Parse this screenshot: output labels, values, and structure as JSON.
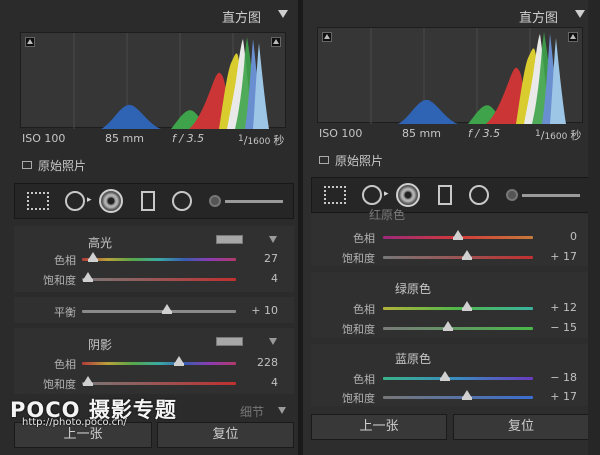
{
  "left_panel": {
    "histogram_title": "直方图",
    "exif": {
      "iso": "ISO 100",
      "focal": "85 mm",
      "aperture": "f / 3.5",
      "shutter_num": "1",
      "shutter_den": "1600",
      "shutter_unit": "秒"
    },
    "original_photo_label": "原始照片",
    "highlights": {
      "title": "高光",
      "hue_label": "色相",
      "hue_value": "27",
      "hue_pos": 0.07,
      "sat_label": "饱和度",
      "sat_value": "4",
      "sat_pos": 0.04
    },
    "balance": {
      "label": "平衡",
      "value": "+ 10",
      "pos": 0.55
    },
    "shadows": {
      "title": "阴影",
      "hue_label": "色相",
      "hue_value": "228",
      "hue_pos": 0.63,
      "sat_label": "饱和度",
      "sat_value": "4",
      "sat_pos": 0.04
    },
    "footer_title": "细节",
    "prev_button": "上一张",
    "reset_button": "复位"
  },
  "right_panel": {
    "histogram_title": "直方图",
    "exif": {
      "iso": "ISO 100",
      "focal": "85 mm",
      "aperture": "f / 3.5",
      "shutter_num": "1",
      "shutter_den": "1600",
      "shutter_unit": "秒"
    },
    "original_photo_label": "原始照片",
    "red_primary": {
      "title": "红原色",
      "hue_label": "色相",
      "hue_value": "0",
      "hue_pos": 0.5,
      "sat_label": "饱和度",
      "sat_value": "+ 17",
      "sat_pos": 0.56
    },
    "green_primary": {
      "title": "绿原色",
      "hue_label": "色相",
      "hue_value": "+ 12",
      "hue_pos": 0.56,
      "sat_label": "饱和度",
      "sat_value": "− 15",
      "sat_pos": 0.43
    },
    "blue_primary": {
      "title": "蓝原色",
      "hue_label": "色相",
      "hue_value": "− 18",
      "hue_pos": 0.41,
      "sat_label": "饱和度",
      "sat_value": "+ 17",
      "sat_pos": 0.56
    },
    "prev_button": "上一张",
    "reset_button": "复位"
  },
  "watermark": {
    "brand": "POCO 摄影专题",
    "url": "http://photo.poco.cn/"
  },
  "colors": {
    "panel_bg": "#2b2b2b",
    "section_bg": "#303030",
    "knob": "#d0d0d0"
  }
}
